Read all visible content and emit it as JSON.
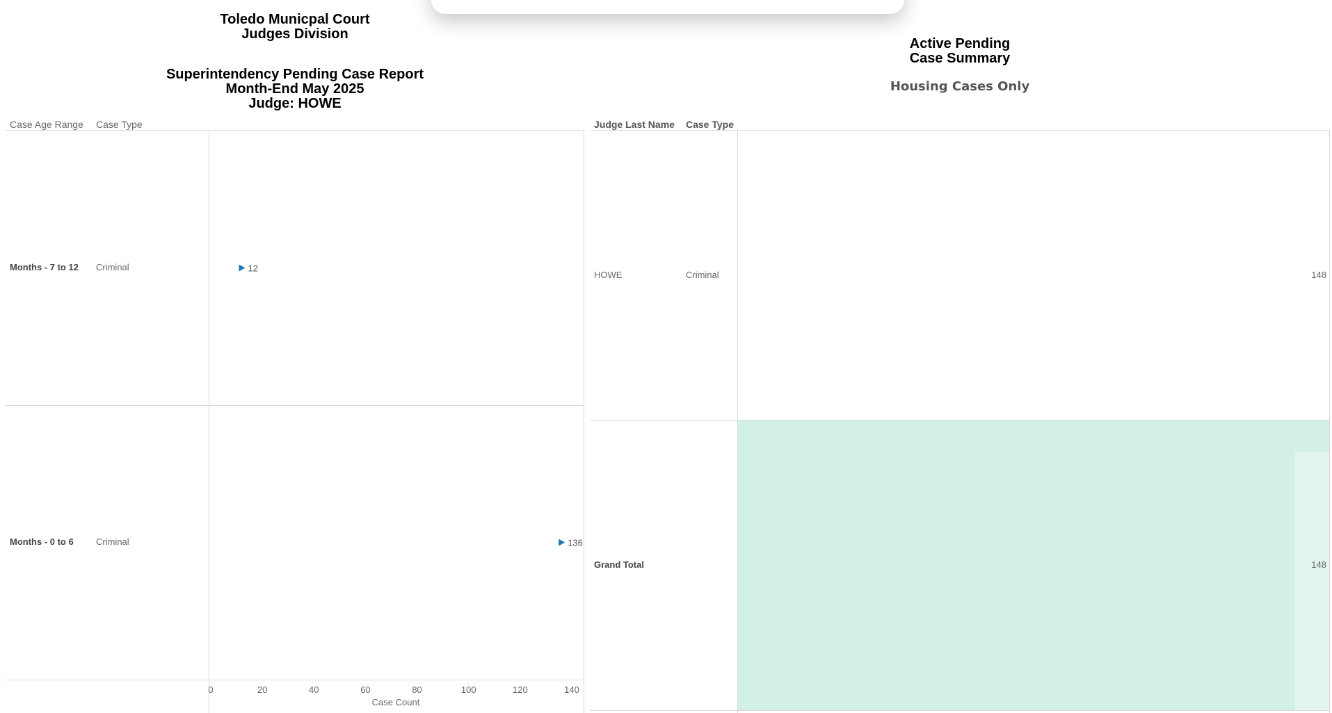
{
  "left_report": {
    "title_lines": [
      "Toledo Municpal Court",
      "Judges Division"
    ],
    "subtitle_lines": [
      "Superintendency Pending Case Report",
      "Month-End May 2025",
      "Judge: HOWE"
    ],
    "col_headers": [
      "Case Age Range",
      "Case Type"
    ]
  },
  "right_report": {
    "title_lines": [
      "Active Pending",
      "Case Summary"
    ],
    "filter_note": "Housing Cases Only",
    "col_headers": [
      "Judge Last Name",
      "Case Type"
    ],
    "rows": [
      {
        "judge": "HOWE",
        "case_type": "Criminal",
        "value": "148"
      }
    ],
    "grand_total": {
      "label": "Grand Total",
      "value": "148"
    },
    "colors": {
      "total_fill": "#d2f0e6"
    }
  },
  "chart_data": {
    "type": "bar",
    "orientation": "horizontal",
    "categories": [
      {
        "age_range": "Months - 7 to 12",
        "case_type": "Criminal"
      },
      {
        "age_range": "Months - 0 to 6",
        "case_type": "Criminal"
      }
    ],
    "values": [
      12,
      136
    ],
    "value_labels": [
      "12",
      "136"
    ],
    "xlabel": "Case Count",
    "xlim": [
      0,
      140
    ],
    "xticks": [
      "0",
      "20",
      "40",
      "60",
      "80",
      "100",
      "120",
      "140"
    ],
    "marker": "right-triangle",
    "marker_color": "#1f77b4"
  }
}
